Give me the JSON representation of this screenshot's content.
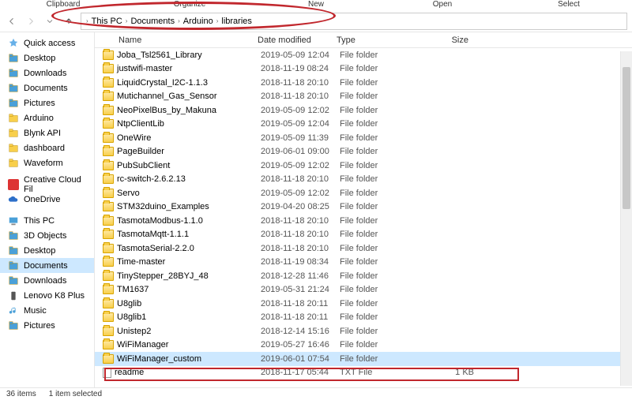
{
  "ribbon": {
    "groups": [
      "Clipboard",
      "Organize",
      "New",
      "Open",
      "Select"
    ]
  },
  "breadcrumb": [
    "This PC",
    "Documents",
    "Arduino",
    "libraries"
  ],
  "sidebar": {
    "top": [
      {
        "label": "Quick access",
        "icon": "star"
      },
      {
        "label": "Desktop",
        "icon": "desktop",
        "pin": true
      },
      {
        "label": "Downloads",
        "icon": "download",
        "pin": true
      },
      {
        "label": "Documents",
        "icon": "doc",
        "pin": true
      },
      {
        "label": "Pictures",
        "icon": "pic",
        "pin": true
      },
      {
        "label": "Arduino",
        "icon": "folder"
      },
      {
        "label": "Blynk API",
        "icon": "folder"
      },
      {
        "label": "dashboard",
        "icon": "folder"
      },
      {
        "label": "Waveform",
        "icon": "folder"
      }
    ],
    "mid": [
      {
        "label": "Creative Cloud Fil",
        "icon": "cc"
      },
      {
        "label": "OneDrive",
        "icon": "cloud"
      }
    ],
    "pc": [
      {
        "label": "This PC",
        "icon": "pc"
      },
      {
        "label": "3D Objects",
        "icon": "3d"
      },
      {
        "label": "Desktop",
        "icon": "desktop"
      },
      {
        "label": "Documents",
        "icon": "doc",
        "selected": true
      },
      {
        "label": "Downloads",
        "icon": "download"
      },
      {
        "label": "Lenovo K8 Plus",
        "icon": "phone"
      },
      {
        "label": "Music",
        "icon": "music"
      },
      {
        "label": "Pictures",
        "icon": "pic"
      }
    ]
  },
  "columns": {
    "name": "Name",
    "date": "Date modified",
    "type": "Type",
    "size": "Size"
  },
  "rows": [
    {
      "name": "Joba_Tsl2561_Library",
      "date": "2019-05-09 12:04",
      "type": "File folder",
      "kind": "folder"
    },
    {
      "name": "justwifi-master",
      "date": "2018-11-19 08:24",
      "type": "File folder",
      "kind": "folder"
    },
    {
      "name": "LiquidCrystal_I2C-1.1.3",
      "date": "2018-11-18 20:10",
      "type": "File folder",
      "kind": "folder"
    },
    {
      "name": "Mutichannel_Gas_Sensor",
      "date": "2018-11-18 20:10",
      "type": "File folder",
      "kind": "folder"
    },
    {
      "name": "NeoPixelBus_by_Makuna",
      "date": "2019-05-09 12:02",
      "type": "File folder",
      "kind": "folder"
    },
    {
      "name": "NtpClientLib",
      "date": "2019-05-09 12:04",
      "type": "File folder",
      "kind": "folder"
    },
    {
      "name": "OneWire",
      "date": "2019-05-09 11:39",
      "type": "File folder",
      "kind": "folder"
    },
    {
      "name": "PageBuilder",
      "date": "2019-06-01 09:00",
      "type": "File folder",
      "kind": "folder"
    },
    {
      "name": "PubSubClient",
      "date": "2019-05-09 12:02",
      "type": "File folder",
      "kind": "folder"
    },
    {
      "name": "rc-switch-2.6.2.13",
      "date": "2018-11-18 20:10",
      "type": "File folder",
      "kind": "folder"
    },
    {
      "name": "Servo",
      "date": "2019-05-09 12:02",
      "type": "File folder",
      "kind": "folder"
    },
    {
      "name": "STM32duino_Examples",
      "date": "2019-04-20 08:25",
      "type": "File folder",
      "kind": "folder"
    },
    {
      "name": "TasmotaModbus-1.1.0",
      "date": "2018-11-18 20:10",
      "type": "File folder",
      "kind": "folder"
    },
    {
      "name": "TasmotaMqtt-1.1.1",
      "date": "2018-11-18 20:10",
      "type": "File folder",
      "kind": "folder"
    },
    {
      "name": "TasmotaSerial-2.2.0",
      "date": "2018-11-18 20:10",
      "type": "File folder",
      "kind": "folder"
    },
    {
      "name": "Time-master",
      "date": "2018-11-19 08:34",
      "type": "File folder",
      "kind": "folder"
    },
    {
      "name": "TinyStepper_28BYJ_48",
      "date": "2018-12-28 11:46",
      "type": "File folder",
      "kind": "folder"
    },
    {
      "name": "TM1637",
      "date": "2019-05-31 21:24",
      "type": "File folder",
      "kind": "folder"
    },
    {
      "name": "U8glib",
      "date": "2018-11-18 20:11",
      "type": "File folder",
      "kind": "folder"
    },
    {
      "name": "U8glib1",
      "date": "2018-11-18 20:11",
      "type": "File folder",
      "kind": "folder"
    },
    {
      "name": "Unistep2",
      "date": "2018-12-14 15:16",
      "type": "File folder",
      "kind": "folder"
    },
    {
      "name": "WiFiManager",
      "date": "2019-05-27 16:46",
      "type": "File folder",
      "kind": "folder"
    },
    {
      "name": "WiFiManager_custom",
      "date": "2019-06-01 07:54",
      "type": "File folder",
      "kind": "folder",
      "selected": true
    },
    {
      "name": "readme",
      "date": "2018-11-17 05:44",
      "type": "TXT File",
      "kind": "file",
      "size": "1 KB"
    }
  ],
  "status": {
    "count": "36 items",
    "selected": "1 item selected"
  }
}
